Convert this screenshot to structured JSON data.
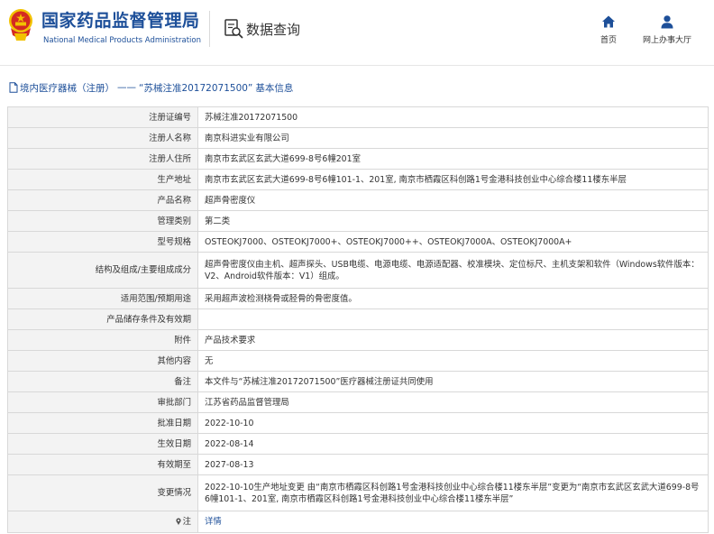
{
  "header": {
    "agency_name_cn": "国家药品监督管理局",
    "agency_name_en": "National Medical Products Administration",
    "search_label": "数据查询",
    "nav": {
      "home": "首页",
      "service_hall": "网上办事大厅"
    }
  },
  "breadcrumb": {
    "category": "境内医疗器械（注册）",
    "separator": "——",
    "record": "“苏械注准20172071500”",
    "suffix": "基本信息"
  },
  "record": {
    "rows": [
      {
        "label": "注册证编号",
        "value": "苏械注准20172071500"
      },
      {
        "label": "注册人名称",
        "value": "南京科进实业有限公司"
      },
      {
        "label": "注册人住所",
        "value": "南京市玄武区玄武大道699-8号6幢201室"
      },
      {
        "label": "生产地址",
        "value": "南京市玄武区玄武大道699-8号6幢101-1、201室, 南京市栖霞区科创路1号金港科技创业中心综合楼11楼东半层"
      },
      {
        "label": "产品名称",
        "value": "超声骨密度仪"
      },
      {
        "label": "管理类别",
        "value": "第二类"
      },
      {
        "label": "型号规格",
        "value": "OSTEOKJ7000、OSTEOKJ7000+、OSTEOKJ7000++、OSTEOKJ7000A、OSTEOKJ7000A+"
      },
      {
        "label": "结构及组成/主要组成成分",
        "value": "超声骨密度仪由主机、超声探头、USB电缆、电源电缆、电源适配器、校准模块、定位标尺、主机支架和软件（Windows软件版本：V2、Android软件版本：V1）组成。"
      },
      {
        "label": "适用范围/预期用途",
        "value": "采用超声波检测桡骨或胫骨的骨密度值。"
      },
      {
        "label": "产品储存条件及有效期",
        "value": ""
      },
      {
        "label": "附件",
        "value": "产品技术要求"
      },
      {
        "label": "其他内容",
        "value": "无"
      },
      {
        "label": "备注",
        "value": "本文件与“苏械注准20172071500”医疗器械注册证共同使用"
      },
      {
        "label": "审批部门",
        "value": "江苏省药品监督管理局"
      },
      {
        "label": "批准日期",
        "value": "2022-10-10"
      },
      {
        "label": "生效日期",
        "value": "2022-08-14"
      },
      {
        "label": "有效期至",
        "value": "2027-08-13"
      },
      {
        "label": "变更情况",
        "value": "2022-10-10生产地址变更 由“南京市栖霞区科创路1号金港科技创业中心综合楼11楼东半层”变更为“南京市玄武区玄武大道699-8号6幢101-1、201室, 南京市栖霞区科创路1号金港科技创业中心综合楼11楼东半层”"
      }
    ],
    "note": {
      "label": "注",
      "icon": "location-pin-icon",
      "link_text": "详情"
    }
  },
  "colors": {
    "brand_blue": "#1d4f99",
    "label_bg": "#f3f3f3",
    "border": "#d8d8d8",
    "emblem_red": "#d42a21",
    "emblem_gold": "#f2c200"
  }
}
